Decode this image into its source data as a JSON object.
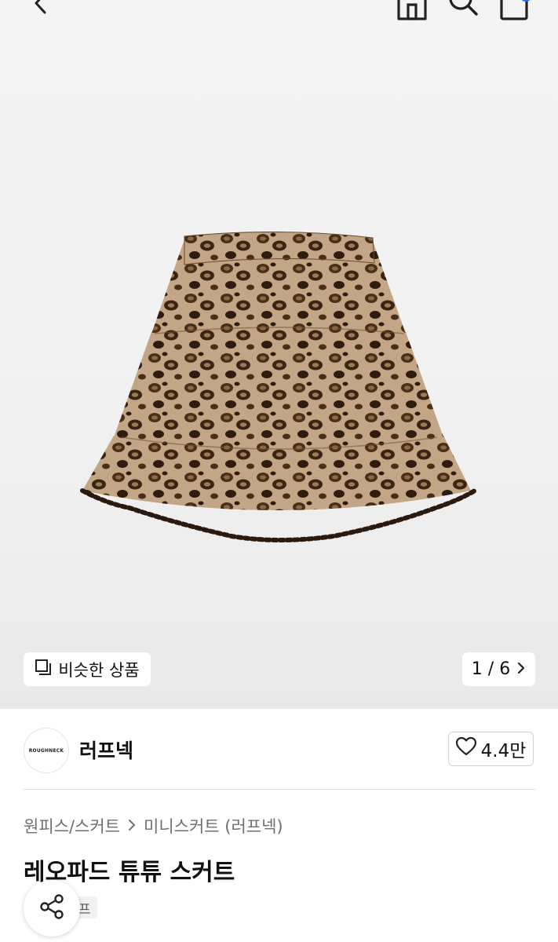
{
  "gallery": {
    "similar_button_label": "비슷한 상품",
    "counter_text": "1 / 6"
  },
  "icons": {
    "back": "chevron-left-icon",
    "home": "home-icon",
    "search": "search-icon",
    "cart": "shopping-bag-icon",
    "similar": "copy-icon",
    "counter_next": "chevron-right-icon",
    "like": "heart-icon",
    "share": "share-icon"
  },
  "brand": {
    "logo_text": "ROUGHNECK",
    "name": "러프넥",
    "likes": "4.4만"
  },
  "product": {
    "breadcrumb_category": "원피스/스커트",
    "breadcrumb_subcategory": "미니스커트 (러프넥)",
    "title": "레오파드 튜튜 스커트",
    "tag_partial": "프"
  },
  "colors": {
    "accent": "#1e6bff",
    "hero_background": "#f1f1f1"
  }
}
